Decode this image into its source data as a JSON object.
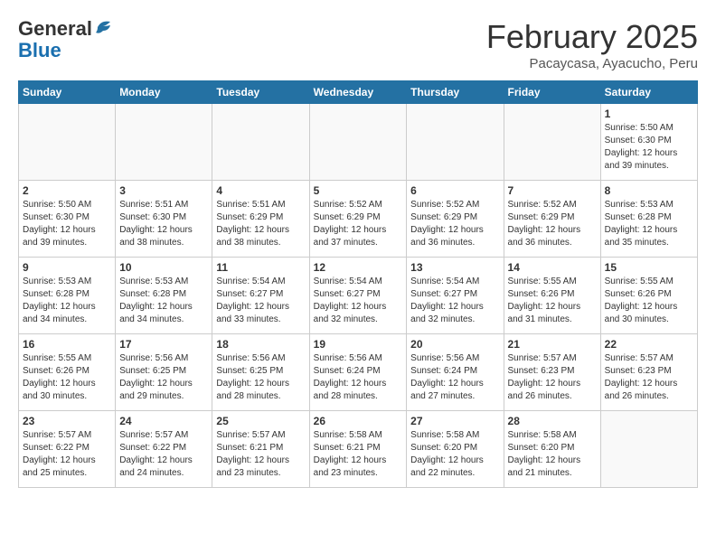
{
  "header": {
    "logo_general": "General",
    "logo_blue": "Blue",
    "month_title": "February 2025",
    "location": "Pacaycasa, Ayacucho, Peru"
  },
  "days_of_week": [
    "Sunday",
    "Monday",
    "Tuesday",
    "Wednesday",
    "Thursday",
    "Friday",
    "Saturday"
  ],
  "weeks": [
    [
      {
        "day": "",
        "info": ""
      },
      {
        "day": "",
        "info": ""
      },
      {
        "day": "",
        "info": ""
      },
      {
        "day": "",
        "info": ""
      },
      {
        "day": "",
        "info": ""
      },
      {
        "day": "",
        "info": ""
      },
      {
        "day": "1",
        "info": "Sunrise: 5:50 AM\nSunset: 6:30 PM\nDaylight: 12 hours\nand 39 minutes."
      }
    ],
    [
      {
        "day": "2",
        "info": "Sunrise: 5:50 AM\nSunset: 6:30 PM\nDaylight: 12 hours\nand 39 minutes."
      },
      {
        "day": "3",
        "info": "Sunrise: 5:51 AM\nSunset: 6:30 PM\nDaylight: 12 hours\nand 38 minutes."
      },
      {
        "day": "4",
        "info": "Sunrise: 5:51 AM\nSunset: 6:29 PM\nDaylight: 12 hours\nand 38 minutes."
      },
      {
        "day": "5",
        "info": "Sunrise: 5:52 AM\nSunset: 6:29 PM\nDaylight: 12 hours\nand 37 minutes."
      },
      {
        "day": "6",
        "info": "Sunrise: 5:52 AM\nSunset: 6:29 PM\nDaylight: 12 hours\nand 36 minutes."
      },
      {
        "day": "7",
        "info": "Sunrise: 5:52 AM\nSunset: 6:29 PM\nDaylight: 12 hours\nand 36 minutes."
      },
      {
        "day": "8",
        "info": "Sunrise: 5:53 AM\nSunset: 6:28 PM\nDaylight: 12 hours\nand 35 minutes."
      }
    ],
    [
      {
        "day": "9",
        "info": "Sunrise: 5:53 AM\nSunset: 6:28 PM\nDaylight: 12 hours\nand 34 minutes."
      },
      {
        "day": "10",
        "info": "Sunrise: 5:53 AM\nSunset: 6:28 PM\nDaylight: 12 hours\nand 34 minutes."
      },
      {
        "day": "11",
        "info": "Sunrise: 5:54 AM\nSunset: 6:27 PM\nDaylight: 12 hours\nand 33 minutes."
      },
      {
        "day": "12",
        "info": "Sunrise: 5:54 AM\nSunset: 6:27 PM\nDaylight: 12 hours\nand 32 minutes."
      },
      {
        "day": "13",
        "info": "Sunrise: 5:54 AM\nSunset: 6:27 PM\nDaylight: 12 hours\nand 32 minutes."
      },
      {
        "day": "14",
        "info": "Sunrise: 5:55 AM\nSunset: 6:26 PM\nDaylight: 12 hours\nand 31 minutes."
      },
      {
        "day": "15",
        "info": "Sunrise: 5:55 AM\nSunset: 6:26 PM\nDaylight: 12 hours\nand 30 minutes."
      }
    ],
    [
      {
        "day": "16",
        "info": "Sunrise: 5:55 AM\nSunset: 6:26 PM\nDaylight: 12 hours\nand 30 minutes."
      },
      {
        "day": "17",
        "info": "Sunrise: 5:56 AM\nSunset: 6:25 PM\nDaylight: 12 hours\nand 29 minutes."
      },
      {
        "day": "18",
        "info": "Sunrise: 5:56 AM\nSunset: 6:25 PM\nDaylight: 12 hours\nand 28 minutes."
      },
      {
        "day": "19",
        "info": "Sunrise: 5:56 AM\nSunset: 6:24 PM\nDaylight: 12 hours\nand 28 minutes."
      },
      {
        "day": "20",
        "info": "Sunrise: 5:56 AM\nSunset: 6:24 PM\nDaylight: 12 hours\nand 27 minutes."
      },
      {
        "day": "21",
        "info": "Sunrise: 5:57 AM\nSunset: 6:23 PM\nDaylight: 12 hours\nand 26 minutes."
      },
      {
        "day": "22",
        "info": "Sunrise: 5:57 AM\nSunset: 6:23 PM\nDaylight: 12 hours\nand 26 minutes."
      }
    ],
    [
      {
        "day": "23",
        "info": "Sunrise: 5:57 AM\nSunset: 6:22 PM\nDaylight: 12 hours\nand 25 minutes."
      },
      {
        "day": "24",
        "info": "Sunrise: 5:57 AM\nSunset: 6:22 PM\nDaylight: 12 hours\nand 24 minutes."
      },
      {
        "day": "25",
        "info": "Sunrise: 5:57 AM\nSunset: 6:21 PM\nDaylight: 12 hours\nand 23 minutes."
      },
      {
        "day": "26",
        "info": "Sunrise: 5:58 AM\nSunset: 6:21 PM\nDaylight: 12 hours\nand 23 minutes."
      },
      {
        "day": "27",
        "info": "Sunrise: 5:58 AM\nSunset: 6:20 PM\nDaylight: 12 hours\nand 22 minutes."
      },
      {
        "day": "28",
        "info": "Sunrise: 5:58 AM\nSunset: 6:20 PM\nDaylight: 12 hours\nand 21 minutes."
      },
      {
        "day": "",
        "info": ""
      }
    ]
  ]
}
